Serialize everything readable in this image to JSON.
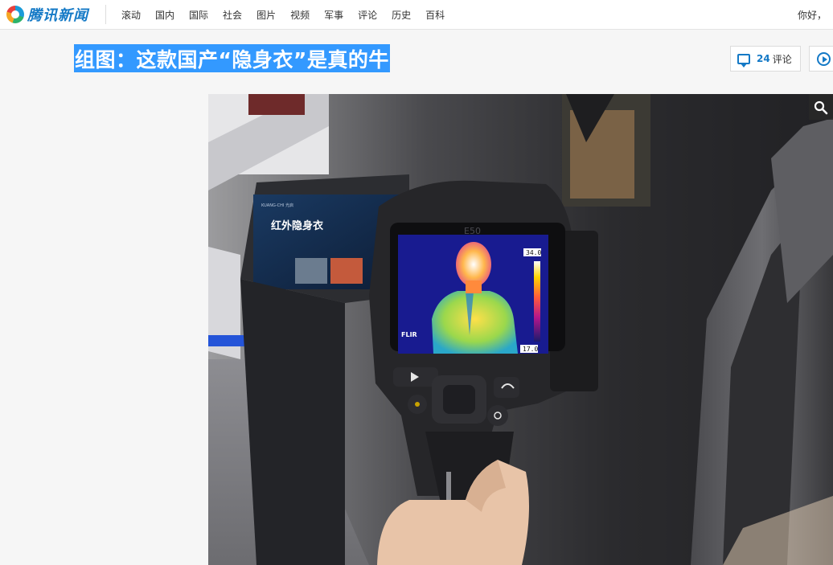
{
  "header": {
    "logo_text": "腾讯新闻",
    "nav": [
      "滚动",
      "国内",
      "国际",
      "社会",
      "图片",
      "视频",
      "军事",
      "评论",
      "历史",
      "百科"
    ],
    "greeting": "你好，"
  },
  "article": {
    "title": "组图：这款国产“隐身衣”是真的牛",
    "comment_count": "24",
    "comment_label": "评论"
  },
  "photo": {
    "panel_brand": "KUANG-CHI 光启",
    "panel_title": "红外隐身衣",
    "camera_model": "E50",
    "camera_brand": "FLIR",
    "temp_max": "34.0",
    "temp_min": "17.0"
  },
  "colors": {
    "brand_blue": "#1479c6",
    "title_highlight": "#3399ff"
  },
  "icons": [
    "logo-icon",
    "comment-icon",
    "play-icon",
    "zoom-icon"
  ]
}
